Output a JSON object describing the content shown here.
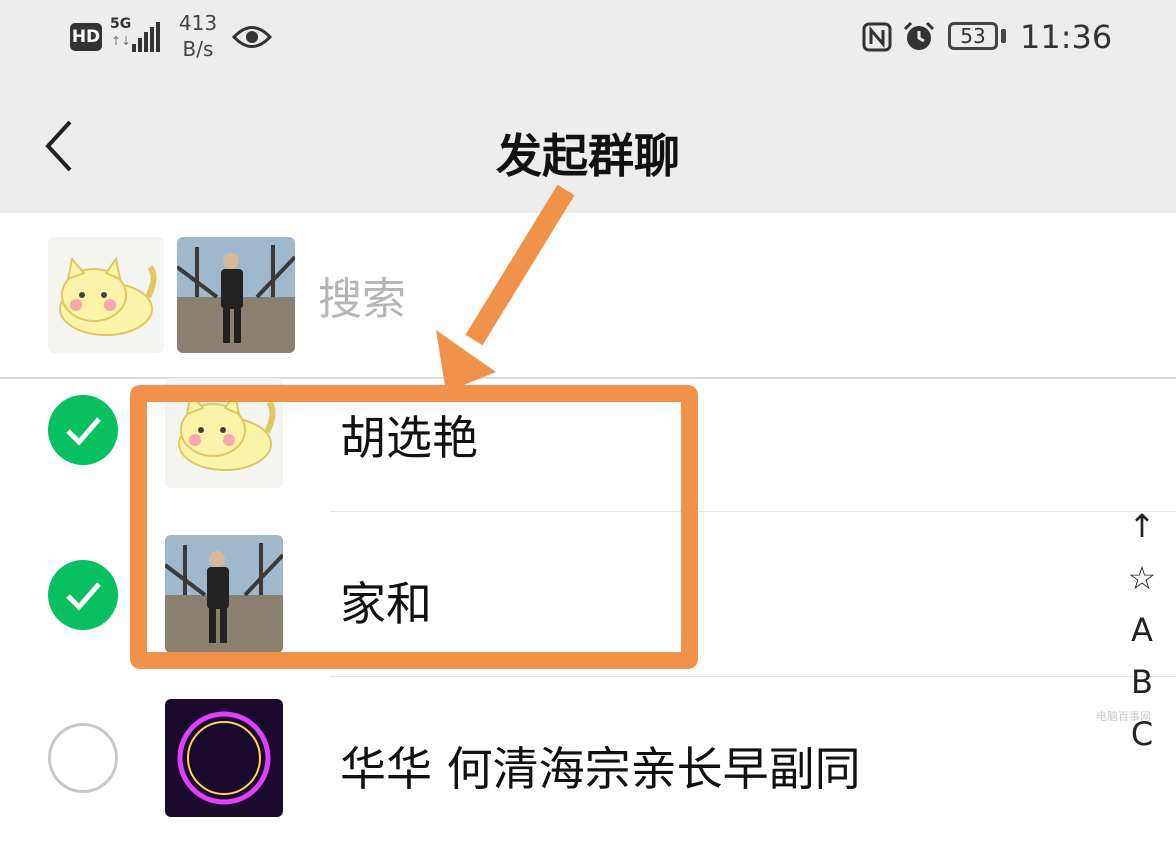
{
  "status_bar": {
    "hd": "HD",
    "network": "5G",
    "net_arrows": "↑↓",
    "speed_value": "413",
    "speed_unit": "B/s",
    "battery": "53",
    "time": "11:36",
    "icons": [
      "eye-icon",
      "nfc-icon",
      "alarm-icon",
      "battery-icon"
    ]
  },
  "nav": {
    "title": "发起群聊",
    "back_icon": "chevron-left-icon"
  },
  "search": {
    "placeholder": "搜索"
  },
  "contacts": [
    {
      "name": "胡选艳",
      "checked": true,
      "avatar": "cartoon-cat"
    },
    {
      "name": "家和",
      "checked": true,
      "avatar": "man-photo"
    },
    {
      "name": "华华 何清海宗亲长早副同",
      "checked": false,
      "avatar": "neon-logo"
    }
  ],
  "index_bar": [
    "↑",
    "☆",
    "A",
    "B",
    "C"
  ],
  "watermark": "电脑百事网",
  "colors": {
    "header_bg": "#ededed",
    "check_green": "#07c160",
    "annotation_orange": "#f0924a"
  }
}
